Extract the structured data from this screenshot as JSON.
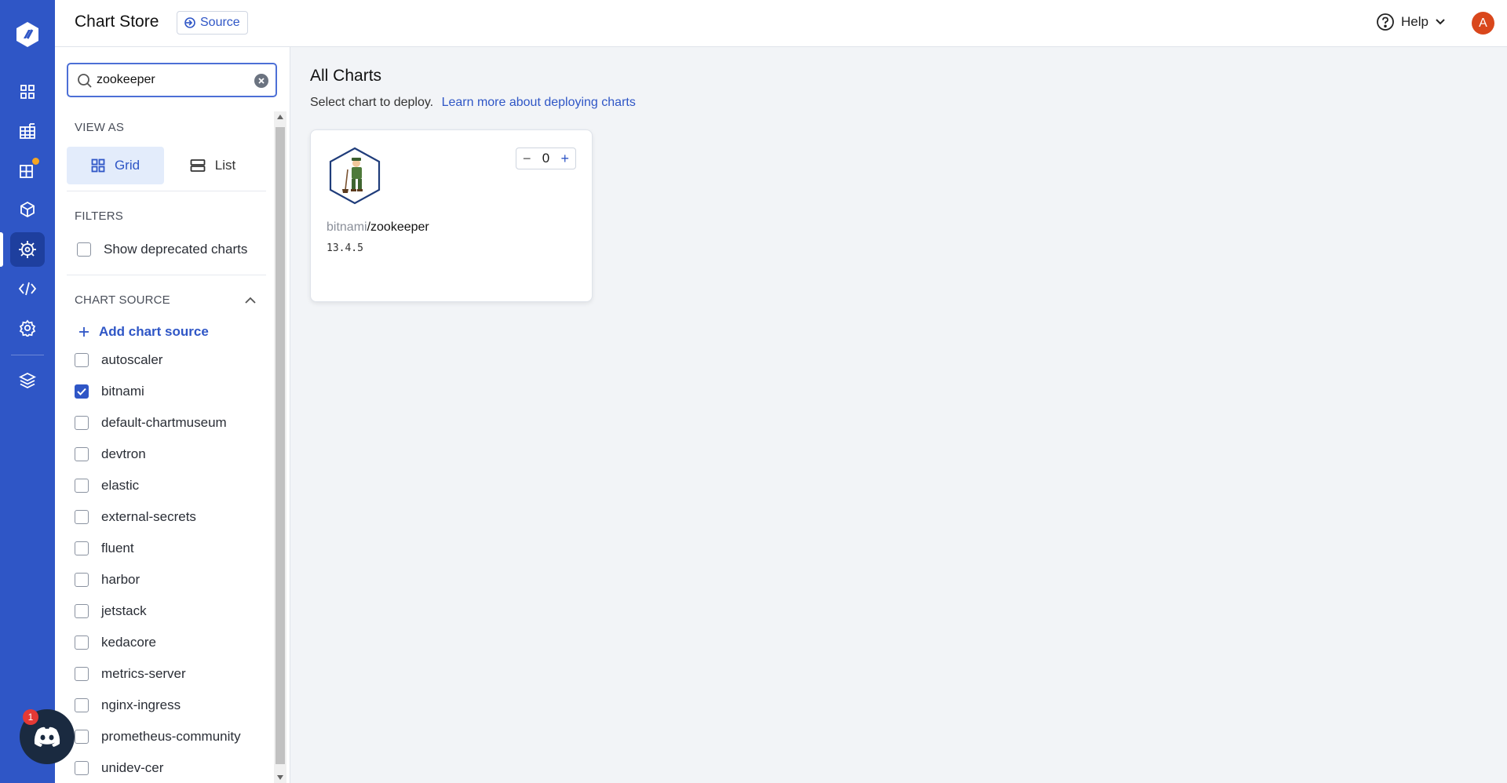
{
  "header": {
    "title": "Chart Store",
    "source_label": "Source",
    "help_label": "Help",
    "avatar_initial": "A"
  },
  "search": {
    "value": "zookeeper"
  },
  "view_as": {
    "label": "VIEW AS",
    "options": [
      {
        "label": "Grid",
        "active": true
      },
      {
        "label": "List",
        "active": false
      }
    ]
  },
  "filters": {
    "label": "FILTERS",
    "deprecated_label": "Show deprecated charts",
    "deprecated_checked": false
  },
  "chart_source": {
    "label": "CHART SOURCE",
    "add_label": "Add chart source",
    "items": [
      {
        "label": "autoscaler",
        "checked": false
      },
      {
        "label": "bitnami",
        "checked": true
      },
      {
        "label": "default-chartmuseum",
        "checked": false
      },
      {
        "label": "devtron",
        "checked": false
      },
      {
        "label": "elastic",
        "checked": false
      },
      {
        "label": "external-secrets",
        "checked": false
      },
      {
        "label": "fluent",
        "checked": false
      },
      {
        "label": "harbor",
        "checked": false
      },
      {
        "label": "jetstack",
        "checked": false
      },
      {
        "label": "kedacore",
        "checked": false
      },
      {
        "label": "metrics-server",
        "checked": false
      },
      {
        "label": "nginx-ingress",
        "checked": false
      },
      {
        "label": "prometheus-community",
        "checked": false
      },
      {
        "label": "unidev-cer",
        "checked": false
      }
    ]
  },
  "main": {
    "title": "All Charts",
    "subtitle": "Select chart to deploy.",
    "learn_link": "Learn more about deploying charts"
  },
  "cards": [
    {
      "repo": "bitnami",
      "name": "/zookeeper",
      "version": "13.4.5",
      "count": "0"
    }
  ],
  "discord_badge": "1",
  "colors": {
    "brand": "#2f56c6",
    "notification_dot": "#f6a623",
    "avatar": "#d9471c"
  }
}
